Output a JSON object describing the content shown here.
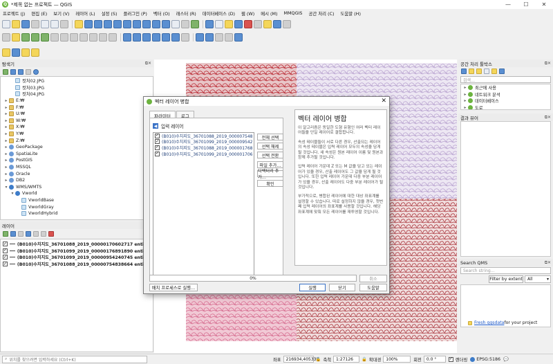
{
  "window": {
    "title": "*제목 없는 프로젝트 — QGIS",
    "app_icon": "Q",
    "minimize": "—",
    "maximize": "☐",
    "close": "✕"
  },
  "menu": [
    "프로젝트 (J)",
    "편집 (E)",
    "보기 (V)",
    "레이어 (L)",
    "설정 (S)",
    "플러그인 (P)",
    "벡터 (O)",
    "래스터 (R)",
    "데이터베이스 (D)",
    "웹 (W)",
    "메시 (M)",
    "MMQGIS",
    "공간 처리 (C)",
    "도움말 (H)"
  ],
  "browser": {
    "title": "탐색기",
    "items": [
      {
        "label": "컷처02.JPG",
        "indent": 1,
        "icon": "image-icon"
      },
      {
        "label": "컷처03.JPG",
        "indent": 1,
        "icon": "image-icon"
      },
      {
        "label": "컷처04.JPG",
        "indent": 1,
        "icon": "image-icon"
      },
      {
        "label": "E:₩",
        "indent": 0,
        "icon": "folder-icon"
      },
      {
        "label": "F:₩",
        "indent": 0,
        "icon": "folder-icon"
      },
      {
        "label": "U:₩",
        "indent": 0,
        "icon": "folder-icon"
      },
      {
        "label": "W:₩",
        "indent": 0,
        "icon": "folder-icon"
      },
      {
        "label": "X:₩",
        "indent": 0,
        "icon": "folder-icon"
      },
      {
        "label": "Y:₩",
        "indent": 0,
        "icon": "folder-icon"
      },
      {
        "label": "Z:₩",
        "indent": 0,
        "icon": "folder-icon"
      },
      {
        "label": "GeoPackage",
        "indent": 0,
        "icon": "database-icon"
      },
      {
        "label": "SpatiaLite",
        "indent": 0,
        "icon": "database-icon"
      },
      {
        "label": "PostGIS",
        "indent": 0,
        "icon": "database-icon"
      },
      {
        "label": "MSSQL",
        "indent": 0,
        "icon": "database-icon"
      },
      {
        "label": "Oracle",
        "indent": 0,
        "icon": "database-icon"
      },
      {
        "label": "DB2",
        "indent": 0,
        "icon": "database-icon"
      },
      {
        "label": "WMS/WMTS",
        "indent": 0,
        "icon": "globe-icon"
      },
      {
        "label": "Vworld",
        "indent": 1,
        "icon": "globe-icon"
      },
      {
        "label": "VworldBase",
        "indent": 2,
        "icon": "image-icon"
      },
      {
        "label": "VworldGray",
        "indent": 2,
        "icon": "image-icon"
      },
      {
        "label": "VworldHybrid",
        "indent": 2,
        "icon": "image-icon"
      }
    ]
  },
  "layers": {
    "title": "레이어",
    "items": [
      "(B010)수치지도_36701088_2019_00000170602717 entities",
      "(B010)수치지도_36701099_2019_00000176891890 entities",
      "(B010)수치지도_36701099_2019_00000954240745 entities",
      "(B010)수치지도_36701088_2019_00000754838664 entities"
    ]
  },
  "dialog": {
    "title": "벡터 레이어 병합",
    "tabs": [
      "파라미터",
      "로그"
    ],
    "input_label": "입력 레이어",
    "input_items": [
      "(B010)수치지도_36701088_2019_000007548",
      "(B010)수치지도_36701099_2019_000009542",
      "(B010)수치지도_36701088_2019_000001768",
      "(B010)수치지도_36701099_2019_000001706"
    ],
    "side_buttons": [
      "전체 선택",
      "선택 해제",
      "선택 전환",
      "파일 추가…",
      "디렉터리 추가…",
      "확인"
    ],
    "help_title": "벡터 레이어 병합",
    "help_paragraphs": [
      "이 알고리즘은 동일한 도형 유형인 여러 벡터 레이어들을 단일 레이어로 결합합니다.",
      "속성 테이블들이 서로 다른 경우, 산출되는 레이어의 속성 테이블은 입력 레이어 모두의 속성을 담게 될 것입니다. 새 속성은 원본 레이어 이름 및 원본과 함께 추가될 것입니다.",
      "입력 레이어 가운데 Z 또는 M 값을 담고 있는 레이어가 있을 경우, 산출 레이어도 그 값을 담게 될 것입니다. 또한 입력 레이어 가운데 다중 부분 레이어가 있을 경우, 산출 레이어도 다중 부분 레이어가 될 것입니다.",
      "부가적으로, 병합된 레이어에 대한 대상 좌표계를 설정할 수 있습니다. 따로 설정하지 않을 경우, 첫번째 입력 레이어의 좌표계를 사용할 것입니다. 해당 좌표계에 맞춰 모든 레이어를 재투영할 것입니다."
    ],
    "progress_label": "0%",
    "progress": 0,
    "cancel": "취소",
    "batch": "배치 프로세스로 실행…",
    "run": "실행",
    "close": "닫기",
    "help": "도움말"
  },
  "processing": {
    "title": "공간 처리 툴박스",
    "search_placeholder": "검색…",
    "items": [
      "최근에 사용",
      "네트워크 분석",
      "데이터베이스",
      "도로",
      "..."
    ]
  },
  "results": {
    "title": "결과 뷰어"
  },
  "qms": {
    "title": "Search QMS",
    "search_placeholder": "Search string...",
    "filter": "Filter by extent",
    "scope": "All",
    "link": "Fresh qgsdata",
    "link_suffix": " for your project"
  },
  "status": {
    "locator_placeholder": "위치를 찾으려면 입력하세요 (Ctrl+K)",
    "coord_label": "좌표",
    "coord": "216934,405338",
    "scale_label": "축척",
    "scale": "1:27126",
    "magnifier_label": "확대경",
    "magnifier": "100%",
    "rotation_label": "회전",
    "rotation": "0.0 °",
    "render": "렌더링",
    "crs": "EPSG:5186"
  },
  "colors": {
    "purple": "#b8a2cf",
    "red": "#b9252f",
    "pink": "#d66a8e",
    "green": "#6cb33f"
  }
}
